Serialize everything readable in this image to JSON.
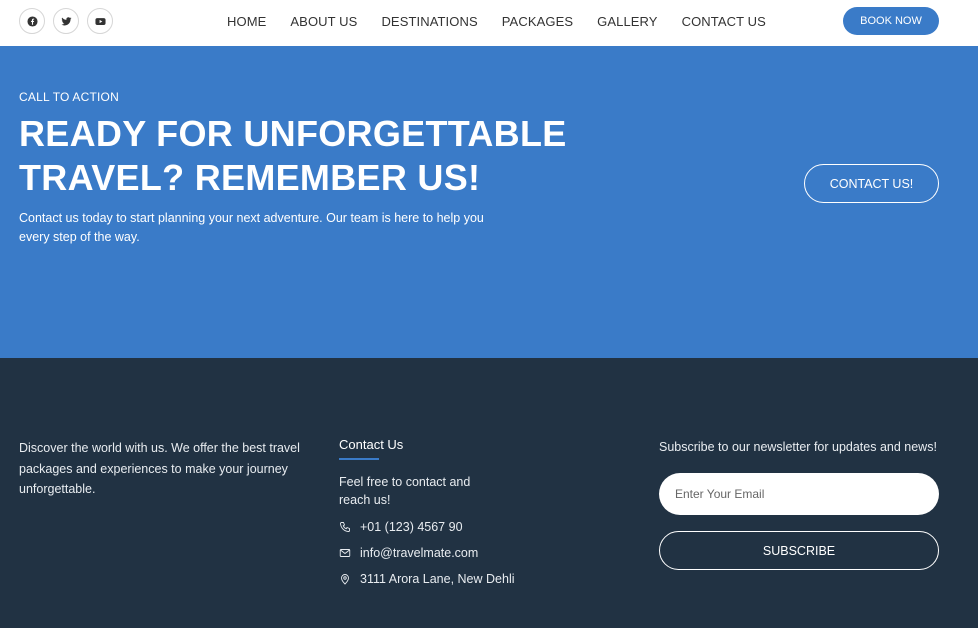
{
  "header": {
    "socials": [
      {
        "icon": "facebook-icon"
      },
      {
        "icon": "twitter-icon"
      },
      {
        "icon": "youtube-icon"
      }
    ],
    "nav": [
      "HOME",
      "ABOUT US",
      "DESTINATIONS",
      "PACKAGES",
      "GALLERY",
      "CONTACT US"
    ],
    "book_label": "BOOK NOW"
  },
  "cta": {
    "eyebrow": "CALL TO ACTION",
    "title_line1": "READY FOR UNFORGETTABLE",
    "title_line2": "TRAVEL? REMEMBER US!",
    "text": "Contact us today to start planning your next adventure. Our team is here to help you every step of the way.",
    "button_label": "CONTACT US!"
  },
  "footer": {
    "about": "Discover the world with us. We offer the best travel packages and experiences to make your journey unforgettable.",
    "contact": {
      "heading": "Contact Us",
      "intro": "Feel free to contact and reach us!",
      "phone": "+01 (123) 4567 90",
      "email": "info@travelmate.com",
      "address": "3111 Arora Lane, New Dehli"
    },
    "newsletter": {
      "text": "Subscribe to our newsletter for updates and news!",
      "placeholder": "Enter Your Email",
      "button_label": "SUBSCRIBE"
    }
  },
  "colors": {
    "accent": "#3a7bc8",
    "footer_bg": "#213243"
  }
}
